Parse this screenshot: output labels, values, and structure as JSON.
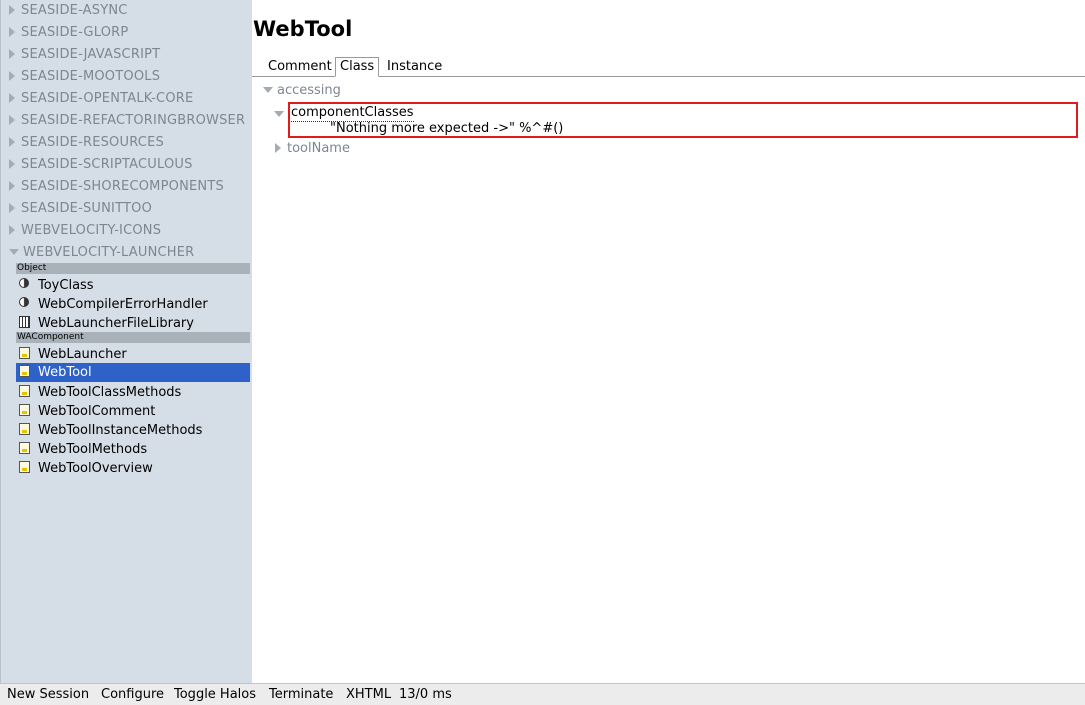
{
  "sidebar": {
    "packages": [
      "SEASIDE-ASYNC",
      "SEASIDE-GLORP",
      "SEASIDE-JAVASCRIPT",
      "SEASIDE-MOOTOOLS",
      "SEASIDE-OPENTALK-CORE",
      "SEASIDE-REFACTORINGBROWSER",
      "SEASIDE-RESOURCES",
      "SEASIDE-SCRIPTACULOUS",
      "SEASIDE-SHORECOMPONENTS",
      "SEASIDE-SUNITTOO",
      "WEBVELOCITY-ICONS",
      "WEBVELOCITY-LAUNCHER"
    ],
    "categories": [
      {
        "name": "Object",
        "classes": [
          {
            "label": "ToyClass",
            "icon": "class-icon"
          },
          {
            "label": "WebCompilerErrorHandler",
            "icon": "class-icon"
          },
          {
            "label": "WebLauncherFileLibrary",
            "icon": "library-icon"
          }
        ]
      },
      {
        "name": "WAComponent",
        "classes": [
          {
            "label": "WebLauncher",
            "icon": "component-icon"
          },
          {
            "label": "WebTool",
            "icon": "component-icon",
            "selected": true
          },
          {
            "label": "WebToolClassMethods",
            "icon": "component-icon"
          },
          {
            "label": "WebToolComment",
            "icon": "component-icon"
          },
          {
            "label": "WebToolInstanceMethods",
            "icon": "component-icon"
          },
          {
            "label": "WebToolMethods",
            "icon": "component-icon"
          },
          {
            "label": "WebToolOverview",
            "icon": "component-icon"
          }
        ]
      }
    ]
  },
  "main": {
    "title": "WebTool",
    "tabs": [
      {
        "label": "Comment"
      },
      {
        "label": "Class",
        "active": true
      },
      {
        "label": "Instance"
      }
    ],
    "protocols": [
      {
        "name": "accessing",
        "expanded": true,
        "methods": [
          {
            "name": "componentClasses",
            "expanded": true,
            "source": "\"Nothing more expected ->\" %^#()"
          }
        ]
      },
      {
        "name": "toolName",
        "expanded": false
      }
    ]
  },
  "statusbar": {
    "links": [
      "New Session",
      "Configure",
      "Toggle Halos",
      "Terminate",
      "XHTML"
    ],
    "timing": "13/0 ms"
  },
  "colors": {
    "sidebar_bg": "#d5dde6",
    "selection": "#2f62c8",
    "method_border": "#e01b1b"
  }
}
